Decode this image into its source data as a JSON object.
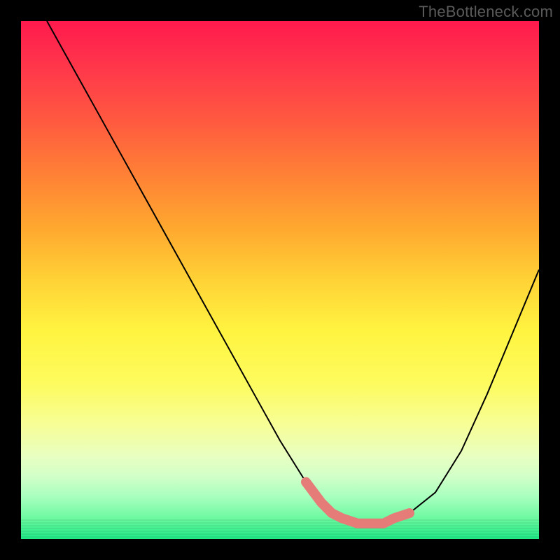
{
  "watermark": "TheBottleneck.com",
  "chart_data": {
    "type": "line",
    "title": "",
    "xlabel": "",
    "ylabel": "",
    "xlim": [
      0,
      100
    ],
    "ylim": [
      0,
      100
    ],
    "series": [
      {
        "name": "bottleneck-curve",
        "x": [
          5,
          10,
          15,
          20,
          25,
          30,
          35,
          40,
          45,
          50,
          55,
          58,
          60,
          62,
          65,
          68,
          70,
          72,
          75,
          80,
          85,
          90,
          95,
          100
        ],
        "values": [
          100,
          91,
          82,
          73,
          64,
          55,
          46,
          37,
          28,
          19,
          11,
          7,
          5,
          4,
          3,
          3,
          3,
          4,
          5,
          9,
          17,
          28,
          40,
          52
        ]
      },
      {
        "name": "highlight-range",
        "x": [
          55,
          58,
          60,
          62,
          65,
          68,
          70,
          72,
          75
        ],
        "values": [
          11,
          7,
          5,
          4,
          3,
          3,
          3,
          4,
          5
        ]
      }
    ],
    "annotations": [],
    "grid": false,
    "legend": false,
    "colors": {
      "gradient_top": "#ff1a4d",
      "gradient_mid": "#fff440",
      "gradient_bottom": "#20e986",
      "curve": "#000000",
      "highlight": "#e57c78",
      "frame": "#000000"
    }
  }
}
